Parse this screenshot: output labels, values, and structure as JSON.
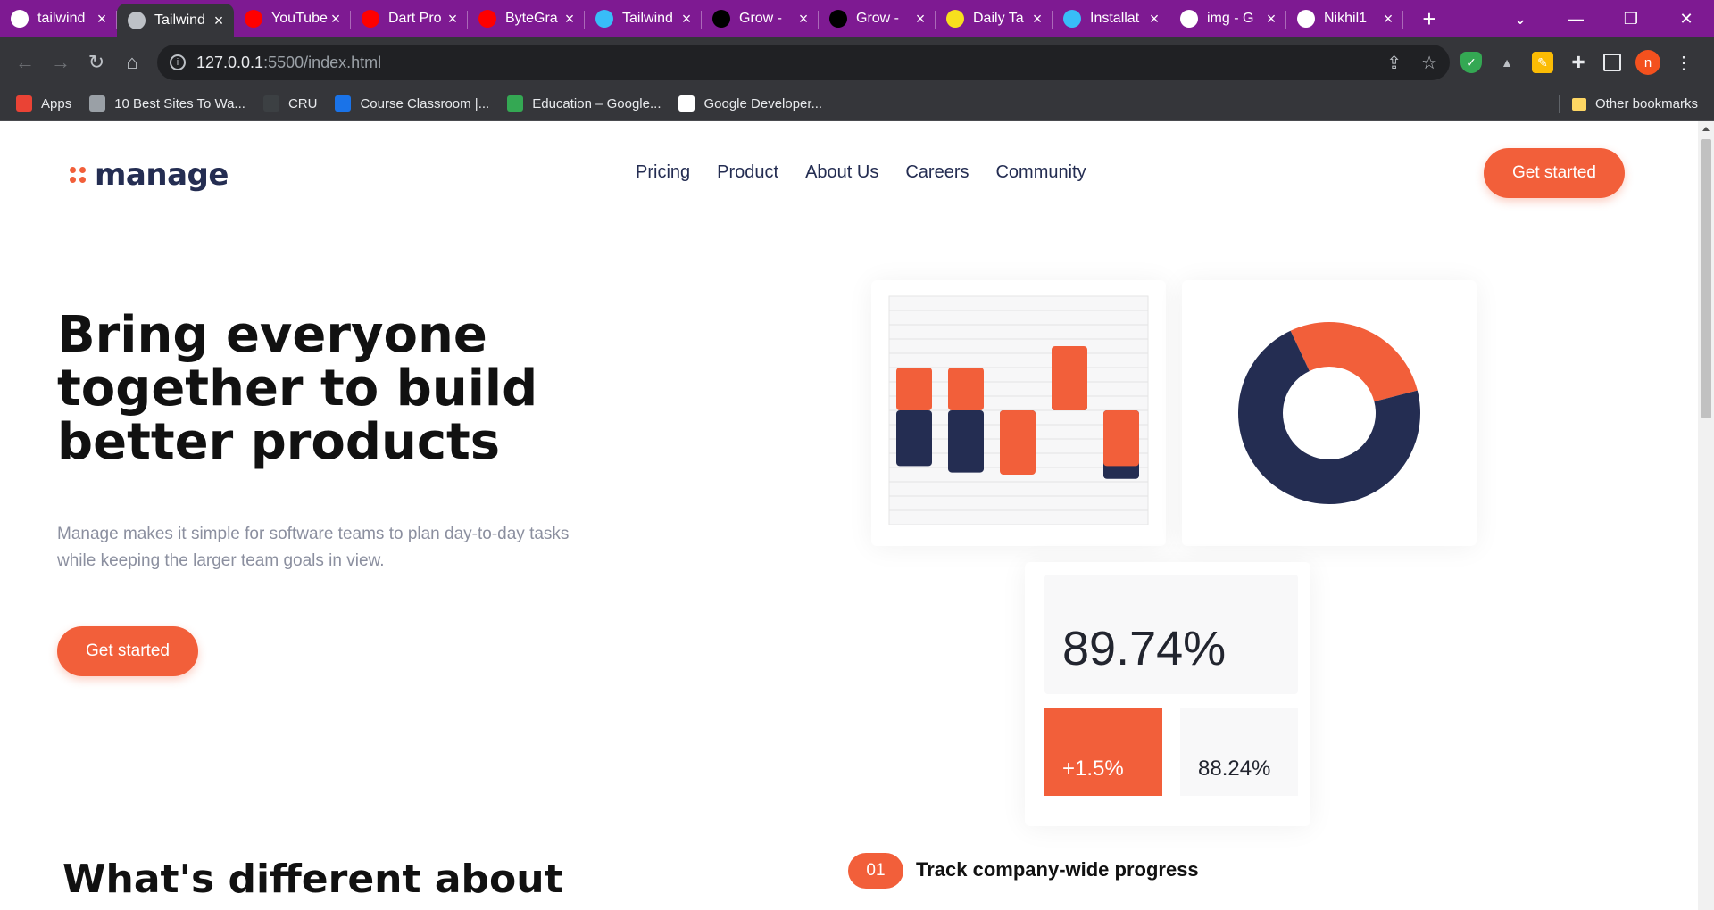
{
  "browser": {
    "tabs": [
      {
        "title": "tailwind",
        "icon": "github-icon",
        "color": "#ffffff"
      },
      {
        "title": "Tailwind",
        "icon": "globe-icon",
        "color": "#bdc1c6"
      },
      {
        "title": "YouTube",
        "icon": "youtube-icon",
        "color": "#ff0000"
      },
      {
        "title": "Dart Pro",
        "icon": "youtube-icon",
        "color": "#ff0000"
      },
      {
        "title": "ByteGra",
        "icon": "youtube-icon",
        "color": "#ff0000"
      },
      {
        "title": "Tailwind",
        "icon": "tailwind-icon",
        "color": "#38bdf8"
      },
      {
        "title": "Grow -",
        "icon": "ab-icon",
        "color": "#000000"
      },
      {
        "title": "Grow -",
        "icon": "ab-icon",
        "color": "#000000"
      },
      {
        "title": "Daily Ta",
        "icon": "xjs-icon",
        "color": "#f7df1e"
      },
      {
        "title": "Installat",
        "icon": "tailwind-icon",
        "color": "#38bdf8"
      },
      {
        "title": "img - G",
        "icon": "google-icon",
        "color": "#ffffff"
      },
      {
        "title": "Nikhil1",
        "icon": "github-icon",
        "color": "#ffffff"
      }
    ],
    "url_host": "127.0.0.1",
    "url_path": ":5500/index.html",
    "profile_initial": "n",
    "bookmarks": [
      {
        "label": "Apps",
        "color": "#ea4335"
      },
      {
        "label": "10 Best Sites To Wa...",
        "color": "#9aa0a6"
      },
      {
        "label": "CRU",
        "color": "#3c4043"
      },
      {
        "label": "Course Classroom |...",
        "color": "#1a73e8"
      },
      {
        "label": "Education – Google...",
        "color": "#34a853"
      },
      {
        "label": "Google Developer...",
        "color": "#ffffff"
      }
    ],
    "other_bookmarks": "Other bookmarks"
  },
  "page": {
    "logo": "manage",
    "nav": [
      "Pricing",
      "Product",
      "About Us",
      "Careers",
      "Community"
    ],
    "header_cta": "Get started",
    "hero_title": "Bring everyone together to build better products",
    "hero_subtitle": "Manage makes it simple for software teams to plan day-to-day tasks while keeping the larger team goals in view.",
    "hero_cta": "Get started",
    "stats": {
      "main": "89.74%",
      "change": "+1.5%",
      "secondary": "88.24%"
    },
    "section_title": "What's different about",
    "feature": {
      "number": "01",
      "title": "Track company-wide progress"
    }
  },
  "colors": {
    "accent": "#f25f3a",
    "navy": "#242d52"
  },
  "chart_data": [
    {
      "type": "bar",
      "series": [
        {
          "color": "#f25f3a",
          "values": [
            1.0,
            1.0,
            -1.5,
            1.5,
            -1.3
          ]
        },
        {
          "color": "#242d52",
          "values": [
            -1.3,
            -1.45,
            -1.0,
            0.5,
            -1.6
          ]
        }
      ]
    },
    {
      "type": "pie",
      "values": [
        72,
        28
      ],
      "colors": [
        "#242d52",
        "#f25f3a"
      ]
    }
  ]
}
